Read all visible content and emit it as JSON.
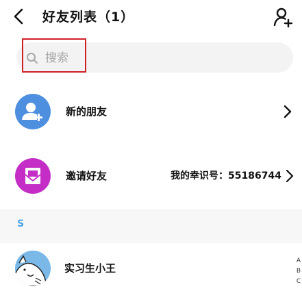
{
  "header": {
    "title": "好友列表（1）",
    "back_icon": "chevron-left-icon",
    "add_icon": "add-user-icon"
  },
  "search": {
    "placeholder": "搜索",
    "value": ""
  },
  "actions": [
    {
      "label": "新的朋友",
      "icon": "add-user-icon",
      "color": "#4f8fe0"
    },
    {
      "label": "邀请好友",
      "icon": "mail-icon",
      "color": "#c42ec7",
      "id_text": "我的幸识号：55186744"
    }
  ],
  "section": {
    "letter": "S",
    "letter_color": "#4aa3e6"
  },
  "contacts": [
    {
      "name": "实习生小王"
    }
  ],
  "alpha_index": [
    "A",
    "B",
    "C"
  ],
  "colors": {
    "highlight": "#cf1f24",
    "search_bg": "#f3f3f3",
    "section_bg": "#f7f7f7"
  }
}
